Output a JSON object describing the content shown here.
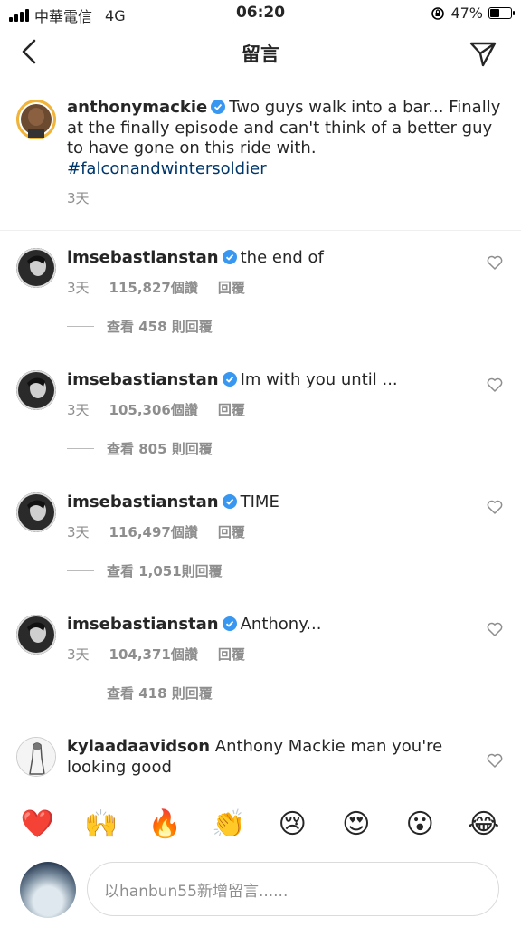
{
  "status_bar": {
    "carrier": "中華電信",
    "network": "4G",
    "time": "06:20",
    "battery": "47%",
    "battery_level": 0.47
  },
  "nav": {
    "title": "留言"
  },
  "caption": {
    "username": "anthonymackie",
    "text": "Two guys walk into a bar... Finally at the finally episode and can't think of a better guy to have gone on this ride with. ",
    "hashtag": "#falconandwintersoldier",
    "age": "3天"
  },
  "comments": [
    {
      "username": "imsebastianstan",
      "text": "the end of",
      "age": "3天",
      "likes": "115,827個讚",
      "reply": "回覆",
      "view_replies": "查看 458 則回覆"
    },
    {
      "username": "imsebastianstan",
      "text": "Im with you until ...",
      "age": "3天",
      "likes": "105,306個讚",
      "reply": "回覆",
      "view_replies": "查看 805 則回覆"
    },
    {
      "username": "imsebastianstan",
      "text": "TIME",
      "age": "3天",
      "likes": "116,497個讚",
      "reply": "回覆",
      "view_replies": "查看 1,051則回覆"
    },
    {
      "username": "imsebastianstan",
      "text": "Anthony...",
      "age": "3天",
      "likes": "104,371個讚",
      "reply": "回覆",
      "view_replies": "查看 418 則回覆"
    },
    {
      "username": "kylaadaavidson",
      "text": "Anthony Mackie man you're looking good"
    }
  ],
  "emoji_bar": [
    "❤️",
    "🙌",
    "🔥",
    "👏",
    "😢",
    "😍",
    "😮",
    "😂"
  ],
  "input": {
    "placeholder": "以hanbun55新增留言......"
  },
  "colors": {
    "verified": "#3897f0",
    "hashtag": "#00376b",
    "secondary_text": "#8e8e8e"
  }
}
